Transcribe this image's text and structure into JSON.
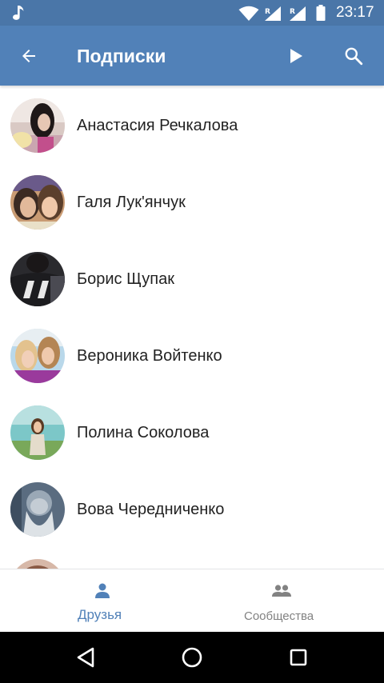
{
  "status_bar": {
    "time": "23:17",
    "signal_badge_1": "R",
    "signal_badge_2": "R",
    "icons": [
      "music-note-icon",
      "wifi-icon",
      "signal-icon",
      "signal-icon",
      "battery-icon"
    ]
  },
  "app_bar": {
    "title": "Подписки",
    "back_icon": "arrow-left-icon",
    "play_icon": "play-icon",
    "search_icon": "search-icon",
    "background_color": "#5181b8"
  },
  "list": {
    "items": [
      {
        "name": "Анастасия Речкалова"
      },
      {
        "name": "Галя Лук'янчук"
      },
      {
        "name": "Борис Щупак"
      },
      {
        "name": "Вероника Войтенко"
      },
      {
        "name": "Полина Соколова"
      },
      {
        "name": "Вова Чередниченко"
      }
    ]
  },
  "bottom_tabs": {
    "friends": {
      "label": "Друзья",
      "icon": "person-icon",
      "active": true,
      "color": "#5181b8"
    },
    "communities": {
      "label": "Сообщества",
      "icon": "people-icon",
      "active": false,
      "color": "#828282"
    }
  },
  "nav_bar": {
    "icons": [
      "back-triangle-icon",
      "home-circle-icon",
      "recents-square-icon"
    ]
  }
}
